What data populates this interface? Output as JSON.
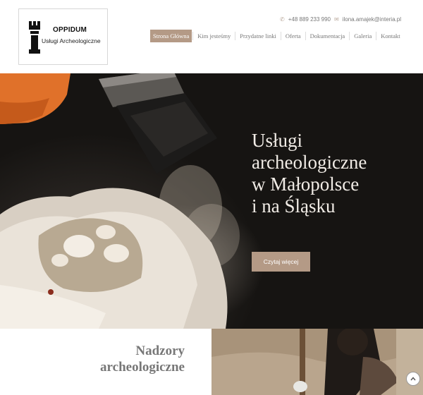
{
  "logo": {
    "title": "OPPIDUM",
    "subtitle": "Usługi Archeologiczne",
    "icon": "tower-icon"
  },
  "contact": {
    "phone": "+48 889 233 990",
    "phone_icon": "phone-icon",
    "email": "ilona.amajek@interia.pl",
    "email_icon": "envelope-icon"
  },
  "nav": {
    "items": [
      {
        "label": "Strona Główna",
        "active": true
      },
      {
        "label": "Kim jesteśmy"
      },
      {
        "label": "Przydatne linki"
      },
      {
        "label": "Oferta"
      },
      {
        "label": "Dokumentacja"
      },
      {
        "label": "Galeria"
      },
      {
        "label": "Kontakt"
      }
    ]
  },
  "hero": {
    "heading_lines": [
      "Usługi",
      "archeologiczne",
      "w Małopolsce",
      "i na Śląsku"
    ],
    "button_label": "Czytaj więcej"
  },
  "section": {
    "heading_lines": [
      "Nadzory",
      "archeologiczne"
    ]
  },
  "colors": {
    "accent": "#b49a86",
    "text_muted": "#777777"
  },
  "icons": {
    "scroll_top": "chevron-up-icon"
  }
}
